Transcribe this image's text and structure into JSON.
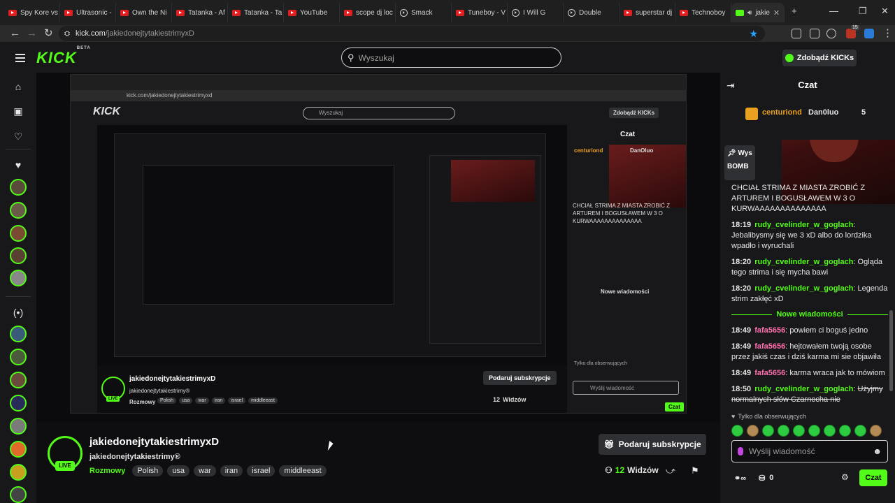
{
  "browser": {
    "tabs": [
      {
        "label": "Spy Kore vs",
        "icon": "youtube-icon"
      },
      {
        "label": "Ultrasonic -",
        "icon": "youtube-icon"
      },
      {
        "label": "Own the Ni",
        "icon": "youtube-icon"
      },
      {
        "label": "Tatanka - Af",
        "icon": "youtube-icon"
      },
      {
        "label": "Tatanka - Ta",
        "icon": "youtube-icon"
      },
      {
        "label": "YouTube",
        "icon": "youtube-icon"
      },
      {
        "label": "scope dj loc",
        "icon": "youtube-icon"
      },
      {
        "label": "Smack",
        "icon": "youtube-music-icon"
      },
      {
        "label": "Tuneboy - V",
        "icon": "youtube-icon"
      },
      {
        "label": "I Will G",
        "icon": "youtube-music-icon"
      },
      {
        "label": "Double",
        "icon": "youtube-music-icon"
      },
      {
        "label": "superstar dj",
        "icon": "youtube-icon"
      },
      {
        "label": "Technoboy",
        "icon": "youtube-icon"
      }
    ],
    "active_tab": {
      "label": "jakie",
      "icon": "kick-icon"
    },
    "url_domain": "kick.com",
    "url_path": "/jakiedonejtytakiestrimyxD",
    "ext_badge": "15"
  },
  "header": {
    "logo": "KICK",
    "logo_beta": "BETA",
    "search_placeholder": "Wyszukaj",
    "get_kicks": "Zdobądź KICKs"
  },
  "channel": {
    "name": "jakiedonejtytakiestrimyxD",
    "subname": "jakiedonejtytakiestrimy®",
    "live": "LIVE",
    "category": "Rozmowy",
    "tags": [
      "Polish",
      "usa",
      "war",
      "iran",
      "israel",
      "middleeast"
    ],
    "subscribe": "Podaruj subskrypcje",
    "viewers_count": "12",
    "viewers_label": "Widzów"
  },
  "chat": {
    "title": "Czat",
    "gifter1": "centuriond",
    "gifter2": "Dan0luo",
    "gift_count": "5",
    "pinned_label": "Wys",
    "pinned_text": "BOMB",
    "messages": [
      {
        "time": "",
        "user": "",
        "text": "CHCIAŁ STRIMA Z MIASTA ZROBIĆ Z ARTUREM I BOGUSŁAWEM W 3 O KURWAAAAAAAAAAAAAA",
        "color": "green"
      },
      {
        "time": "18:19",
        "user": "rudy_cvelinder_w_goglach",
        "text": "Jebalibysmy się we 3 xD albo do lordzika wpadło i wyruchali",
        "color": "green"
      },
      {
        "time": "18:20",
        "user": "rudy_cvelinder_w_goglach",
        "text": "Ogląda tego strima i się mycha bawi",
        "color": "green"
      },
      {
        "time": "18:20",
        "user": "rudy_cvelinder_w_goglach",
        "text": "Legenda strim zakłęć xD",
        "color": "green"
      }
    ],
    "new_messages": "Nowe wiadomości",
    "messages_new": [
      {
        "time": "18:49",
        "user": "fafa5656",
        "text": "powiem ci boguś jedno",
        "color": "pink"
      },
      {
        "time": "18:49",
        "user": "fafa5656",
        "text": "hejtowałem twoją osobe przez jakiś czas i dziś karma mi sie objawiła",
        "color": "pink"
      },
      {
        "time": "18:49",
        "user": "fafa5656",
        "text": "karma wraca jak to mówiom",
        "color": "pink"
      },
      {
        "time": "18:50",
        "user": "rudy_cvelinder_w_goglach",
        "text": "Użyjmy normalnych słów Czarnocha nie",
        "color": "green"
      }
    ],
    "followers_only": "Tylko dla obserwujących",
    "input_placeholder": "Wyślij wiadomość",
    "points": "0",
    "send": "Czat"
  },
  "nested": {
    "channel_name": "jakiedonejtytakiestrimyxD",
    "channel_sub": "jakiedonejtytakiestrimy®",
    "category": "Rozmowy",
    "tags": [
      "Polish",
      "usa",
      "war",
      "iran",
      "israel",
      "middleeast"
    ],
    "subscribe": "Podaruj subskrypcje",
    "viewers": "12",
    "viewers_label": "Widzów",
    "chat_title": "Czat",
    "gifter1": "centuriond",
    "gifter2": "DanOluo",
    "search": "Wyszukaj",
    "kicks": "Zdobądź KICKs",
    "url": "kick.com/jakiedonejtytakiestrimyxd",
    "msg1": "CHCIAŁ STRIMA Z MIASTA ZROBIĆ Z ARTUREM I BOGUSŁAWEM W 3 O KURWAAAAAAAAAAAAAA",
    "new_messages": "Nowe wiadomości",
    "input_placeholder": "Wyślij wiadomość",
    "send": "Czat",
    "followers_only": "Tylko dla obserwujących",
    "live": "LIVE"
  }
}
